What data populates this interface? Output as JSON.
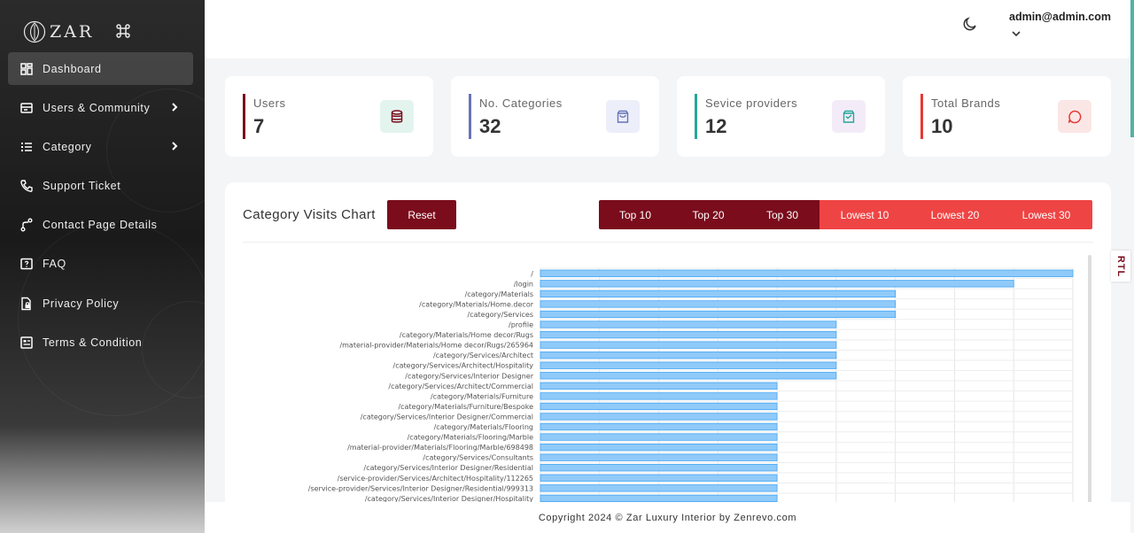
{
  "brand": {
    "name": "ZAR"
  },
  "sidebar": {
    "items": [
      {
        "label": "Dashboard",
        "icon": "dashboard-icon",
        "active": true,
        "has_children": false
      },
      {
        "label": "Users & Community",
        "icon": "users-icon",
        "active": false,
        "has_children": true
      },
      {
        "label": "Category",
        "icon": "category-icon",
        "active": false,
        "has_children": true
      },
      {
        "label": "Support Ticket",
        "icon": "phone-icon",
        "active": false,
        "has_children": false
      },
      {
        "label": "Contact Page Details",
        "icon": "route-icon",
        "active": false,
        "has_children": false
      },
      {
        "label": "FAQ",
        "icon": "faq-icon",
        "active": false,
        "has_children": false
      },
      {
        "label": "Privacy Policy",
        "icon": "document-lock-icon",
        "active": false,
        "has_children": false
      },
      {
        "label": "Terms & Condition",
        "icon": "terms-icon",
        "active": false,
        "has_children": false
      }
    ]
  },
  "header": {
    "user_email": "admin@admin.com",
    "theme_icon": "moon-icon"
  },
  "stats": [
    {
      "label": "Users",
      "value": "7",
      "accent": "#7a0c1c",
      "icon": "database-icon",
      "icon_bg": "#e3f4ef"
    },
    {
      "label": "No. Categories",
      "value": "32",
      "accent": "#6674b8",
      "icon": "bag-icon",
      "icon_bg": "#eceef9"
    },
    {
      "label": "Sevice providers",
      "value": "12",
      "accent": "#26a69a",
      "icon": "bag-check-icon",
      "icon_bg": "#f3ecf8"
    },
    {
      "label": "Total Brands",
      "value": "10",
      "accent": "#e53935",
      "icon": "chat-icon",
      "icon_bg": "#fbe6e6"
    }
  ],
  "chart_panel": {
    "title": "Category Visits Chart",
    "reset_label": "Reset",
    "filters": [
      {
        "label": "Top 10",
        "style": "dark"
      },
      {
        "label": "Top 20",
        "style": "dark"
      },
      {
        "label": "Top 30",
        "style": "dark"
      },
      {
        "label": "Lowest 10",
        "style": "light"
      },
      {
        "label": "Lowest 20",
        "style": "light"
      },
      {
        "label": "Lowest 30",
        "style": "light"
      }
    ]
  },
  "chart_data": {
    "type": "bar",
    "orientation": "horizontal",
    "title": "",
    "xlabel": "",
    "ylabel": "",
    "xlim": [
      0,
      9
    ],
    "grid": true,
    "bar_color": "#90caf9",
    "bar_edge_color": "#42a5f5",
    "categories": [
      "/",
      "/login",
      "/category/Materials",
      "/category/Materials/Home.decor",
      "/category/Services",
      "/profile",
      "/category/Materials/Home decor/Rugs",
      "/material-provider/Materials/Home decor/Rugs/265964",
      "/category/Services/Architect",
      "/category/Services/Architect/Hospitality",
      "/category/Services/Interior Designer",
      "/category/Services/Architect/Commercial",
      "/category/Materials/Furniture",
      "/category/Materials/Furniture/Bespoke",
      "/category/Services/Interior Designer/Commercial",
      "/category/Materials/Flooring",
      "/category/Materials/Flooring/Marble",
      "/material-provider/Materials/Flooring/Marble/698498",
      "/category/Services/Consultants",
      "/category/Services/Interior Designer/Residential",
      "/service-provider/Services/Architect/Hospitality/112265",
      "/service-provider/Services/Interior Designer/Residential/999313",
      "/category/Services/Interior Designer/Hospitality"
    ],
    "values": [
      9,
      8,
      6,
      6,
      6,
      5,
      5,
      5,
      5,
      5,
      5,
      4,
      4,
      4,
      4,
      4,
      4,
      4,
      4,
      4,
      4,
      4,
      4
    ]
  },
  "rtl_label": "RTL",
  "footer": {
    "text": "Copyright 2024 © Zar Luxury Interior by Zenrevo.com"
  }
}
